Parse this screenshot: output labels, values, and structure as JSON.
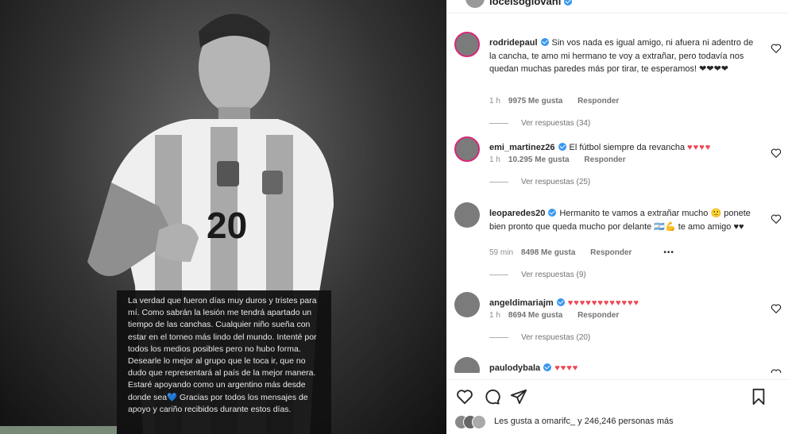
{
  "post": {
    "owner": "locelsogiovani",
    "jersey_number": "20",
    "story_text": "La verdad que fueron días muy duros y tristes para mí. Como sabrán la lesión me tendrá apartado un tiempo de las canchas. Cualquier niño sueña con estar en el torneo más lindo del mundo. Intenté por todos los medios posibles pero no hubo forma. Desearle lo mejor al grupo que le toca ir, que no dudo que representará al país de la mejor manera. Estaré apoyando como un argentino más desde donde sea💙 Gracias por todos los mensajes de apoyo y cariño recibidos durante estos días."
  },
  "comments": [
    {
      "user": "rodridepaul",
      "text": "Sin vos nada es igual amigo, ni afuera ni adentro de la cancha, te amo mi hermano te voy a extrañar, pero todavía nos quedan muchas paredes más por tirar, te esperamos! ❤❤❤❤",
      "time": "1 h",
      "likes": "9975 Me gusta",
      "reply": "Responder",
      "replies": "Ver respuestas (34)"
    },
    {
      "user": "emi_martinez26",
      "text": "El fútbol siempre da revancha",
      "hearts": "♥♥♥♥",
      "time": "1 h",
      "likes": "10.295 Me gusta",
      "reply": "Responder",
      "replies": "Ver respuestas (25)"
    },
    {
      "user": "leoparedes20",
      "text": "Hermanito te vamos a extrañar mucho 🙁 ponete bien pronto que queda mucho por delante 🇦🇷💪 te amo amigo ♥♥",
      "time": "59 min",
      "likes": "8498 Me gusta",
      "reply": "Responder",
      "more": "•••",
      "replies": "Ver respuestas (9)"
    },
    {
      "user": "angeldimariajm",
      "text": "",
      "hearts": "♥♥♥♥♥♥♥♥♥♥♥♥",
      "time": "1 h",
      "likes": "8694 Me gusta",
      "reply": "Responder",
      "replies": "Ver respuestas (20)"
    },
    {
      "user": "paulodybala",
      "text": "",
      "hearts": "♥♥♥♥"
    }
  ],
  "likes_summary": "Les gusta a omarifc_ y 246,246 personas más",
  "colors": {
    "verified": "#3897f0",
    "heart": "#ed4956",
    "meta": "#8e8e8e"
  },
  "icons": [
    "like-icon",
    "comment-icon",
    "share-icon",
    "save-icon"
  ]
}
